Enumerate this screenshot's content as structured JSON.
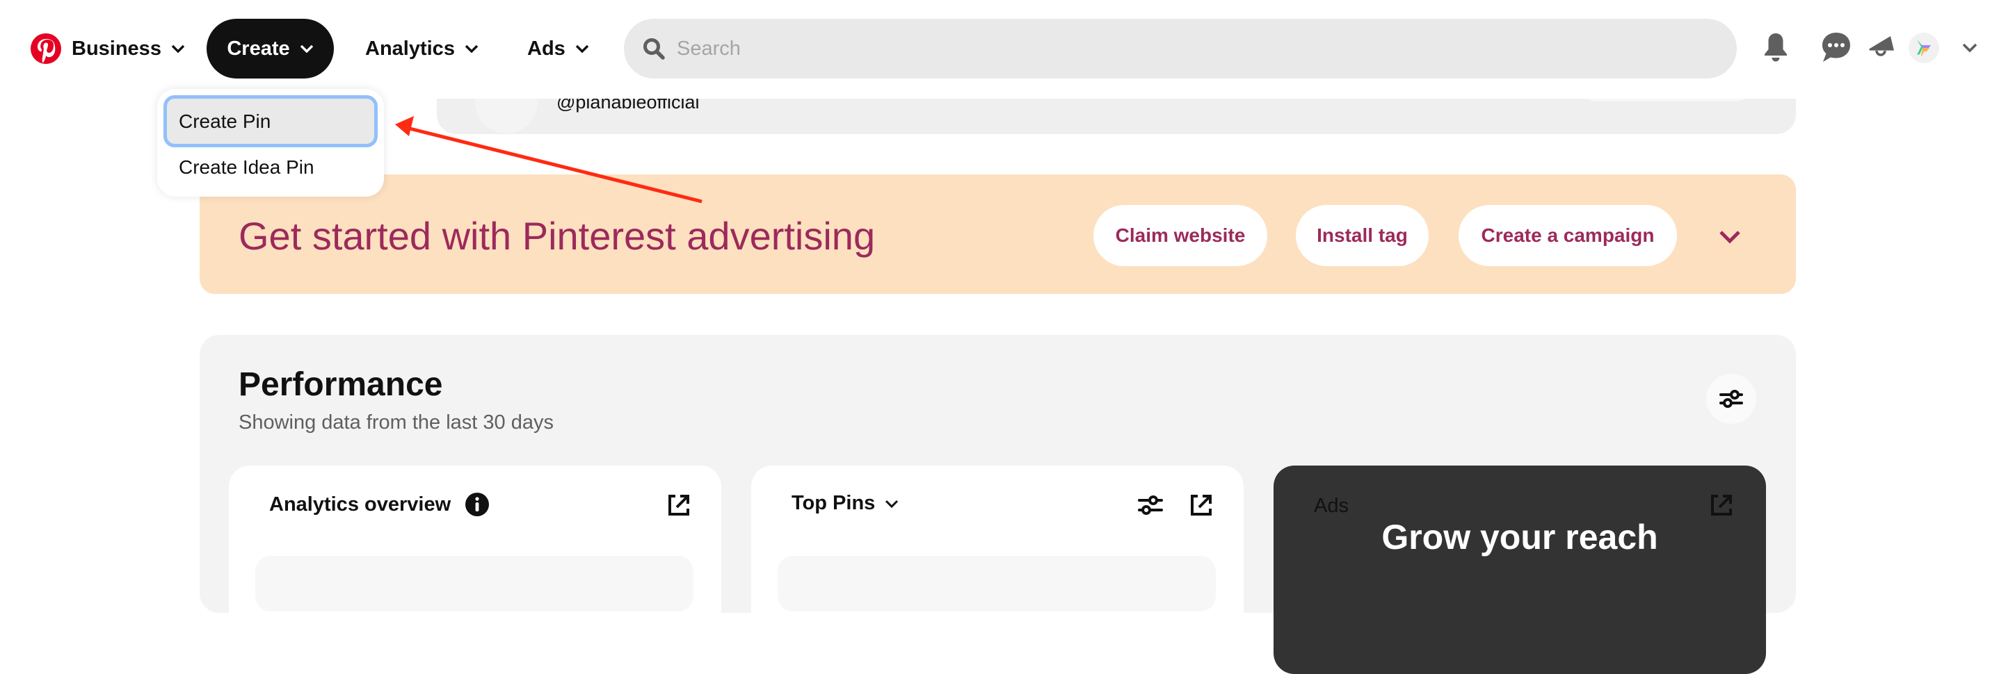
{
  "nav": {
    "logo": "pinterest-logo",
    "items": [
      {
        "label": "Business",
        "has_chevron": true
      },
      {
        "label": "Create",
        "has_chevron": true,
        "active": true
      },
      {
        "label": "Analytics",
        "has_chevron": true
      },
      {
        "label": "Ads",
        "has_chevron": true
      }
    ],
    "search": {
      "placeholder": "Search",
      "value": ""
    },
    "icons": [
      "bell-icon",
      "chat-icon",
      "megaphone-icon",
      "account-avatar",
      "chevron-down-icon"
    ]
  },
  "create_menu": {
    "items": [
      {
        "label": "Create Pin",
        "highlighted": true
      },
      {
        "label": "Create Idea Pin",
        "highlighted": false
      }
    ]
  },
  "profile": {
    "handle": "@planableofficial"
  },
  "banner": {
    "title": "Get started with Pinterest advertising",
    "buttons": [
      "Claim website",
      "Install tag",
      "Create a campaign"
    ],
    "text_color": "#9c2a5b",
    "background": "#fde0c0"
  },
  "performance": {
    "title": "Performance",
    "subtitle": "Showing data from the last 30 days",
    "cards": {
      "analytics_overview": {
        "title": "Analytics overview"
      },
      "top_pins": {
        "title": "Top Pins"
      },
      "ads": {
        "label": "Ads",
        "headline": "Grow your reach"
      }
    }
  },
  "annotation": {
    "arrow_color": "#ff2a12",
    "points_to": "Create Pin"
  },
  "colors": {
    "brand_red": "#e60023",
    "highlight_border": "#92c0fb",
    "nav_active_bg": "#111111"
  }
}
